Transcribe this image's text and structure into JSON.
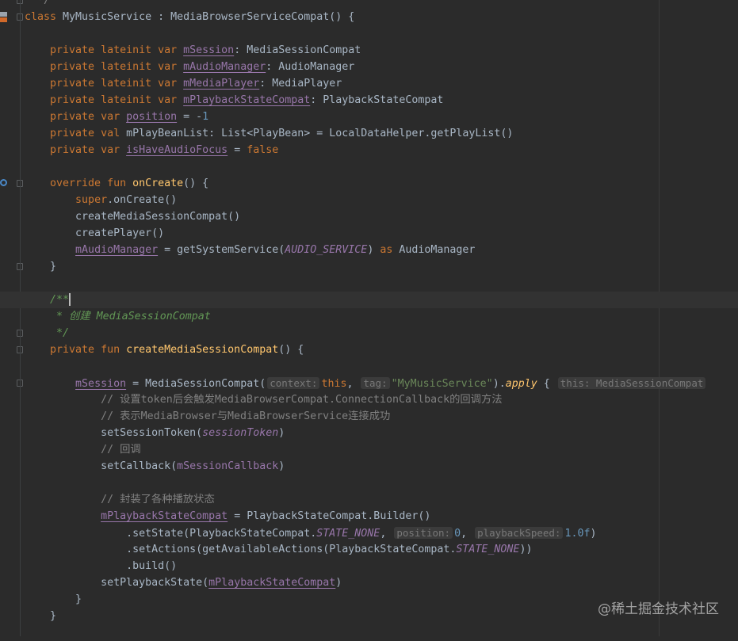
{
  "editor": {
    "lines": [
      [
        [
          "  */",
          "c"
        ]
      ],
      [
        [
          "class",
          "k"
        ],
        [
          " MyMusicService : MediaBrowserServiceCompat() {",
          "p"
        ]
      ],
      [],
      [
        [
          "    private lateinit var ",
          "k"
        ],
        [
          "mSession",
          "fu"
        ],
        [
          ": MediaSessionCompat",
          "p"
        ]
      ],
      [
        [
          "    private lateinit var ",
          "k"
        ],
        [
          "mAudioManager",
          "fu"
        ],
        [
          ": AudioManager",
          "p"
        ]
      ],
      [
        [
          "    private lateinit var ",
          "k"
        ],
        [
          "mMediaPlayer",
          "fu"
        ],
        [
          ": MediaPlayer",
          "p"
        ]
      ],
      [
        [
          "    private lateinit var ",
          "k"
        ],
        [
          "mPlaybackStateCompat",
          "fu"
        ],
        [
          ": PlaybackStateCompat",
          "p"
        ]
      ],
      [
        [
          "    private var ",
          "k"
        ],
        [
          "position",
          "fu"
        ],
        [
          " = -",
          "p"
        ],
        [
          "1",
          "n"
        ]
      ],
      [
        [
          "    private val ",
          "k"
        ],
        [
          "mPlayBeanList: List<PlayBean> = LocalDataHelper.getPlayList()",
          "p"
        ]
      ],
      [
        [
          "    private var ",
          "k"
        ],
        [
          "isHaveAudioFocus",
          "fu"
        ],
        [
          " = ",
          "p"
        ],
        [
          "false",
          "k"
        ]
      ],
      [],
      [
        [
          "    override fun ",
          "k"
        ],
        [
          "onCreate",
          "fn"
        ],
        [
          "() {",
          "p"
        ]
      ],
      [
        [
          "        ",
          "p"
        ],
        [
          "super",
          "k"
        ],
        [
          ".onCreate()",
          "p"
        ]
      ],
      [
        [
          "        createMediaSessionCompat()",
          "p"
        ]
      ],
      [
        [
          "        createPlayer()",
          "p"
        ]
      ],
      [
        [
          "        ",
          "p"
        ],
        [
          "mAudioManager",
          "fu"
        ],
        [
          " = getSystemService(",
          "p"
        ],
        [
          "AUDIO_SERVICE",
          "const"
        ],
        [
          ") ",
          "p"
        ],
        [
          "as",
          "k"
        ],
        [
          " AudioManager",
          "p"
        ]
      ],
      [
        [
          "    }",
          "p"
        ]
      ],
      [],
      [
        [
          "    /**",
          "d"
        ],
        [
          "",
          "caret"
        ]
      ],
      [
        [
          "     * 创建 MediaSessionCompat",
          "d"
        ]
      ],
      [
        [
          "     */",
          "d"
        ]
      ],
      [
        [
          "    private fun ",
          "k"
        ],
        [
          "createMediaSessionCompat",
          "fn"
        ],
        [
          "() {",
          "p"
        ]
      ],
      [],
      [
        [
          "        ",
          "p"
        ],
        [
          "mSession",
          "fu"
        ],
        [
          " = MediaSessionCompat(",
          "p"
        ],
        [
          "context:",
          "h"
        ],
        [
          "this",
          "k"
        ],
        [
          ", ",
          "p"
        ],
        [
          "tag:",
          "h"
        ],
        [
          "\"MyMusicService\"",
          "s"
        ],
        [
          ").",
          "p"
        ],
        [
          "apply",
          "ext"
        ],
        [
          " { ",
          "p"
        ],
        [
          "this: MediaSessionCompat",
          "h"
        ]
      ],
      [
        [
          "            // 设置token后会触发MediaBrowserCompat.ConnectionCallback的回调方法",
          "c"
        ]
      ],
      [
        [
          "            // 表示MediaBrowser与MediaBrowserService连接成功",
          "c"
        ]
      ],
      [
        [
          "            setSessionToken(",
          "p"
        ],
        [
          "sessionToken",
          "fi"
        ],
        [
          ")",
          "p"
        ]
      ],
      [
        [
          "            // 回调",
          "c"
        ]
      ],
      [
        [
          "            setCallback(",
          "p"
        ],
        [
          "mSessionCallback",
          "fp"
        ],
        [
          ")",
          "p"
        ]
      ],
      [],
      [
        [
          "            // 封装了各种播放状态",
          "c"
        ]
      ],
      [
        [
          "            ",
          "p"
        ],
        [
          "mPlaybackStateCompat",
          "fu"
        ],
        [
          " = PlaybackStateCompat.Builder()",
          "p"
        ]
      ],
      [
        [
          "                .setState(PlaybackStateCompat.",
          "p"
        ],
        [
          "STATE_NONE",
          "const"
        ],
        [
          ", ",
          "p"
        ],
        [
          "position:",
          "h"
        ],
        [
          "0",
          "n"
        ],
        [
          ", ",
          "p"
        ],
        [
          "playbackSpeed:",
          "h"
        ],
        [
          "1.0f",
          "n"
        ],
        [
          ")",
          "p"
        ]
      ],
      [
        [
          "                .setActions(getAvailableActions(PlaybackStateCompat.",
          "p"
        ],
        [
          "STATE_NONE",
          "const"
        ],
        [
          "))",
          "p"
        ]
      ],
      [
        [
          "                .build()",
          "p"
        ]
      ],
      [
        [
          "            setPlaybackState(",
          "p"
        ],
        [
          "mPlaybackStateCompat",
          "fu"
        ],
        [
          ")",
          "p"
        ]
      ],
      [
        [
          "        }",
          "p"
        ]
      ],
      [
        [
          "    }",
          "p"
        ]
      ],
      []
    ],
    "current_line": 18,
    "fold_marker_lines": [
      0,
      1,
      11,
      16,
      18,
      20,
      21,
      23
    ]
  },
  "watermark": "@稀土掘金技术社区",
  "colors": {
    "background": "#2b2b2b",
    "keyword": "#cc7832",
    "field": "#9876aa",
    "function": "#ffc66d",
    "number": "#6897bb",
    "comment": "#808080",
    "doc_comment": "#629755",
    "string": "#6a8759"
  }
}
